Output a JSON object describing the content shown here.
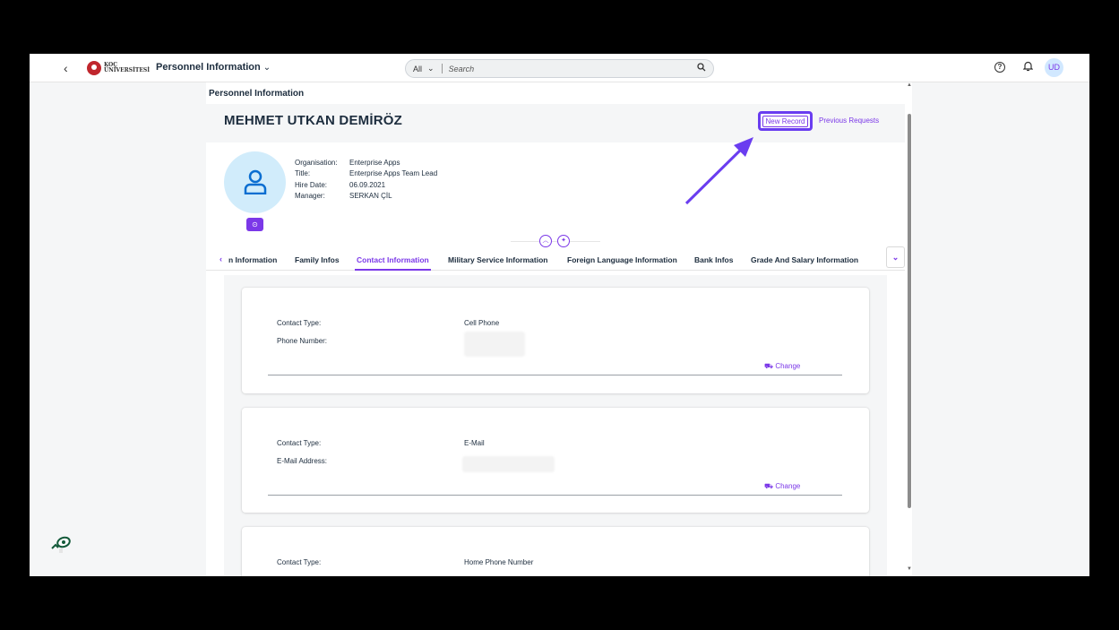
{
  "shell": {
    "back_icon": "chevron-left-icon",
    "logo_line1": "KOÇ",
    "logo_line2": "ÜNİVERSİTESİ",
    "app_title": "Personnel Information",
    "search_scope": "All",
    "search_placeholder": "Search",
    "avatar_initials": "UD"
  },
  "page": {
    "header": "Personnel Information",
    "employee_name": "MEHMET UTKAN DEMİRÖZ",
    "new_record_label": "New Record",
    "previous_requests_label": "Previous Requests"
  },
  "employee": {
    "fields": [
      {
        "label": "Organisation:",
        "value": "Enterprise Apps"
      },
      {
        "label": "Title:",
        "value": "Enterprise Apps Team Lead"
      },
      {
        "label": "Hire Date:",
        "value": "06.09.2021"
      },
      {
        "label": "Manager:",
        "value": "SERKAN ÇİL"
      }
    ]
  },
  "tabs": [
    {
      "label": "n Information"
    },
    {
      "label": "Family Infos"
    },
    {
      "label": "Contact Information",
      "active": true
    },
    {
      "label": "Military Service Information"
    },
    {
      "label": "Foreign Language Information"
    },
    {
      "label": "Bank Infos"
    },
    {
      "label": "Grade And Salary Information"
    }
  ],
  "cards": [
    {
      "type_label": "Contact Type:",
      "type_value": "Cell Phone",
      "second_label": "Phone Number:",
      "change_label": "Change"
    },
    {
      "type_label": "Contact Type:",
      "type_value": "E-Mail",
      "second_label": "E-Mail Address:",
      "change_label": "Change"
    },
    {
      "type_label": "Contact Type:",
      "type_value": "Home Phone Number"
    }
  ],
  "colors": {
    "accent": "#7b38e8",
    "annotation_arrow": "#6a3df0"
  }
}
